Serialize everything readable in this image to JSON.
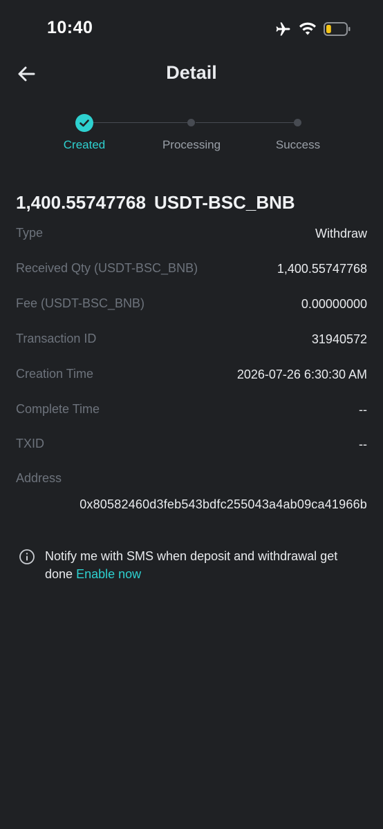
{
  "status_bar": {
    "time": "10:40",
    "icons": [
      "airplane-icon",
      "wifi-icon",
      "battery-icon"
    ],
    "battery_level": 0.25,
    "battery_color": "#f5c518"
  },
  "header": {
    "title": "Detail",
    "back_icon": "arrow-left-icon"
  },
  "stepper": {
    "steps": [
      {
        "label": "Created",
        "state": "done"
      },
      {
        "label": "Processing",
        "state": "pending"
      },
      {
        "label": "Success",
        "state": "pending"
      }
    ],
    "accent_color": "#2ed1d0"
  },
  "amount": {
    "value": "1,400.55747768",
    "currency": "USDT-BSC_BNB"
  },
  "details": [
    {
      "label": "Type",
      "value": "Withdraw"
    },
    {
      "label": "Received Qty (USDT-BSC_BNB)",
      "value": "1,400.55747768"
    },
    {
      "label": "Fee (USDT-BSC_BNB)",
      "value": "0.00000000"
    },
    {
      "label": "Transaction ID",
      "value": "31940572"
    },
    {
      "label": "Creation Time",
      "value": "2026-07-26 6:30:30 AM"
    },
    {
      "label": "Complete Time",
      "value": "--"
    },
    {
      "label": "TXID",
      "value": "--"
    }
  ],
  "address": {
    "label": "Address",
    "value": "0x80582460d3feb543bdfc255043a4ab09ca41966b"
  },
  "notify": {
    "icon": "info-icon",
    "text": "Notify me with SMS when deposit and withdrawal get done",
    "link": "Enable now"
  }
}
